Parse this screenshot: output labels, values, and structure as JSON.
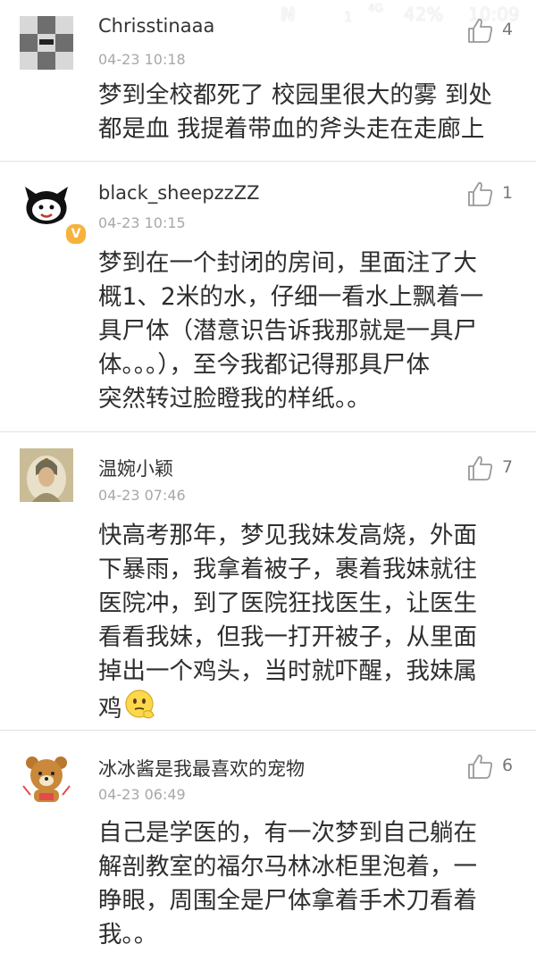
{
  "status_bar": {
    "network_icon": "N",
    "signal": "4G",
    "sim": "1",
    "battery": "42%",
    "time": "10:09"
  },
  "comments": [
    {
      "username": "Chrisstinaaa",
      "timestamp": "04-23 10:18",
      "likes": "4",
      "avatar": "checker-pattern-avatar",
      "lines": [
        "梦到全校都死了 校园里很大的雾 到处",
        "都是血 我提着带血的斧头走在走廊上"
      ]
    },
    {
      "username": "black_sheepzzZZ",
      "timestamp": "04-23 10:15",
      "likes": "1",
      "avatar": "cartoon-sheep-avatar",
      "verified": "V",
      "lines": [
        "梦到在一个封闭的房间，里面注了大",
        "概1、2米的水，仔细一看水上飘着一",
        "具尸体（潜意识告诉我那就是一具尸",
        "体。。。），至今我都记得那具尸体",
        "突然转过脸瞪我的样纸。。"
      ]
    },
    {
      "username": "温婉小颖",
      "timestamp": "04-23 07:46",
      "likes": "7",
      "avatar": "guanyin-painting-avatar",
      "lines": [
        "快高考那年，梦见我妹发高烧，外面",
        "下暴雨，我拿着被子，裹着我妹就往",
        "医院冲，到了医院狂找医生，让医生",
        "看看我妹，但我一打开被子，从里面",
        "掉出一个鸡头，当时就吓醒，我妹属",
        "鸡"
      ],
      "trailing_emoji": "thinking-face-emoji"
    },
    {
      "username": "冰冰酱是我最喜欢的宠物",
      "timestamp": "04-23 06:49",
      "likes": "6",
      "avatar": "rilakkuma-bear-avatar",
      "lines": [
        "自己是学医的，有一次梦到自己躺在",
        "解剖教室的福尔马林冰柜里泡着，一",
        "睁眼，周围全是尸体拿着手术刀看着",
        "我。。"
      ]
    }
  ]
}
